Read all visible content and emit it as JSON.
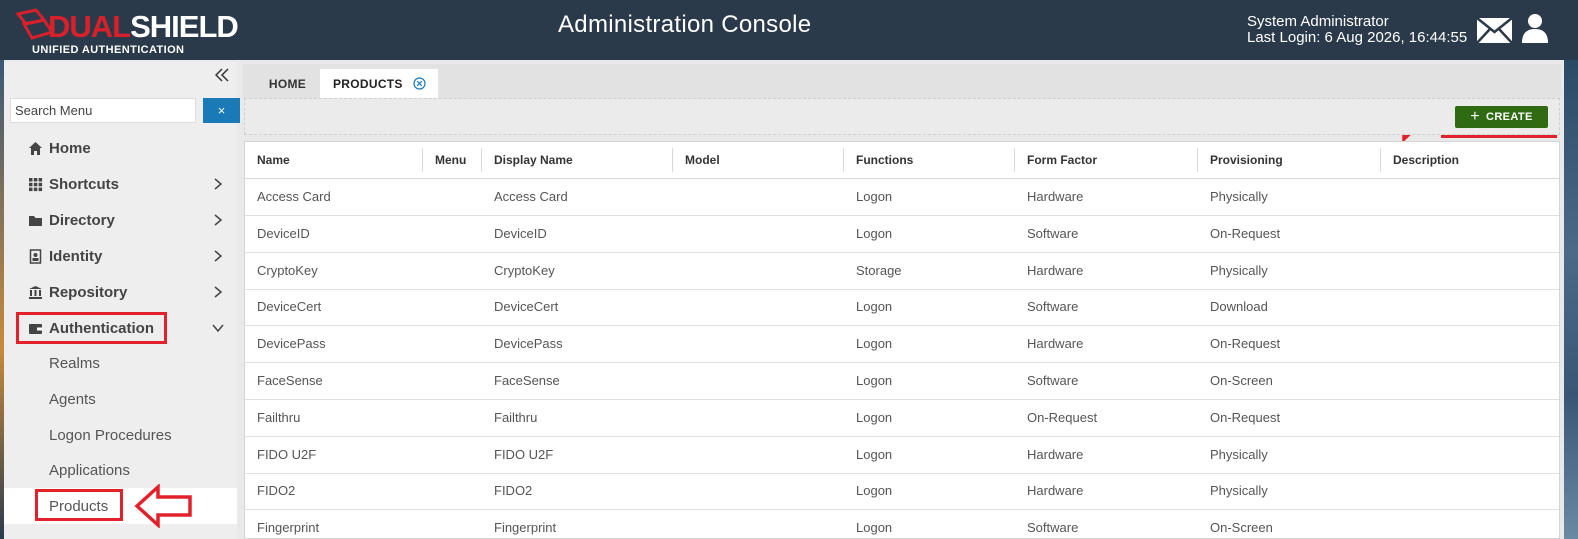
{
  "header": {
    "logo_prefix": "DUAL",
    "logo_suffix": "SHIELD",
    "logo_tagline": "UNIFIED AUTHENTICATION",
    "title": "Administration Console",
    "user_name": "System Administrator",
    "last_login": "Last Login: 6 Aug 2026, 16:44:55",
    "icons": {
      "mail": "mail-icon",
      "user": "user-icon"
    }
  },
  "sidebar": {
    "search_placeholder": "Search Menu",
    "search_clear_label": "×",
    "items": [
      {
        "label": "Home",
        "icon": "home-icon"
      },
      {
        "label": "Shortcuts",
        "icon": "grid-icon"
      },
      {
        "label": "Directory",
        "icon": "folder-icon"
      },
      {
        "label": "Identity",
        "icon": "id-badge-icon"
      },
      {
        "label": "Repository",
        "icon": "bank-icon"
      },
      {
        "label": "Authentication",
        "icon": "wallet-icon"
      }
    ],
    "sub_items": [
      "Realms",
      "Agents",
      "Logon Procedures",
      "Applications",
      "Products"
    ],
    "active_sub_item": "Products"
  },
  "tabs": [
    {
      "label": "HOME"
    },
    {
      "label": "PRODUCTS"
    }
  ],
  "toolbar": {
    "create_label": "CREATE"
  },
  "table": {
    "columns": [
      "Name",
      "Menu",
      "Display Name",
      "Model",
      "Functions",
      "Form Factor",
      "Provisioning",
      "Description"
    ],
    "rows": [
      [
        "Access Card",
        "",
        "Access Card",
        "",
        "Logon",
        "Hardware",
        "Physically",
        ""
      ],
      [
        "DeviceID",
        "",
        "DeviceID",
        "",
        "Logon",
        "Software",
        "On-Request",
        ""
      ],
      [
        "CryptoKey",
        "",
        "CryptoKey",
        "",
        "Storage",
        "Hardware",
        "Physically",
        ""
      ],
      [
        "DeviceCert",
        "",
        "DeviceCert",
        "",
        "Logon",
        "Software",
        "Download",
        ""
      ],
      [
        "DevicePass",
        "",
        "DevicePass",
        "",
        "Logon",
        "Hardware",
        "On-Request",
        ""
      ],
      [
        "FaceSense",
        "",
        "FaceSense",
        "",
        "Logon",
        "Software",
        "On-Screen",
        ""
      ],
      [
        "Failthru",
        "",
        "Failthru",
        "",
        "Logon",
        "On-Request",
        "On-Request",
        ""
      ],
      [
        "FIDO U2F",
        "",
        "FIDO U2F",
        "",
        "Logon",
        "Hardware",
        "Physically",
        ""
      ],
      [
        "FIDO2",
        "",
        "FIDO2",
        "",
        "Logon",
        "Hardware",
        "Physically",
        ""
      ],
      [
        "Fingerprint",
        "",
        "Fingerprint",
        "",
        "Logon",
        "Software",
        "On-Screen",
        ""
      ]
    ]
  },
  "colors": {
    "header_bg": "#2b3a4a",
    "brand_red": "#d8202a",
    "create_green": "#2f6b12",
    "search_blue": "#1a7ab8",
    "annotation_red": "#e3212b"
  }
}
